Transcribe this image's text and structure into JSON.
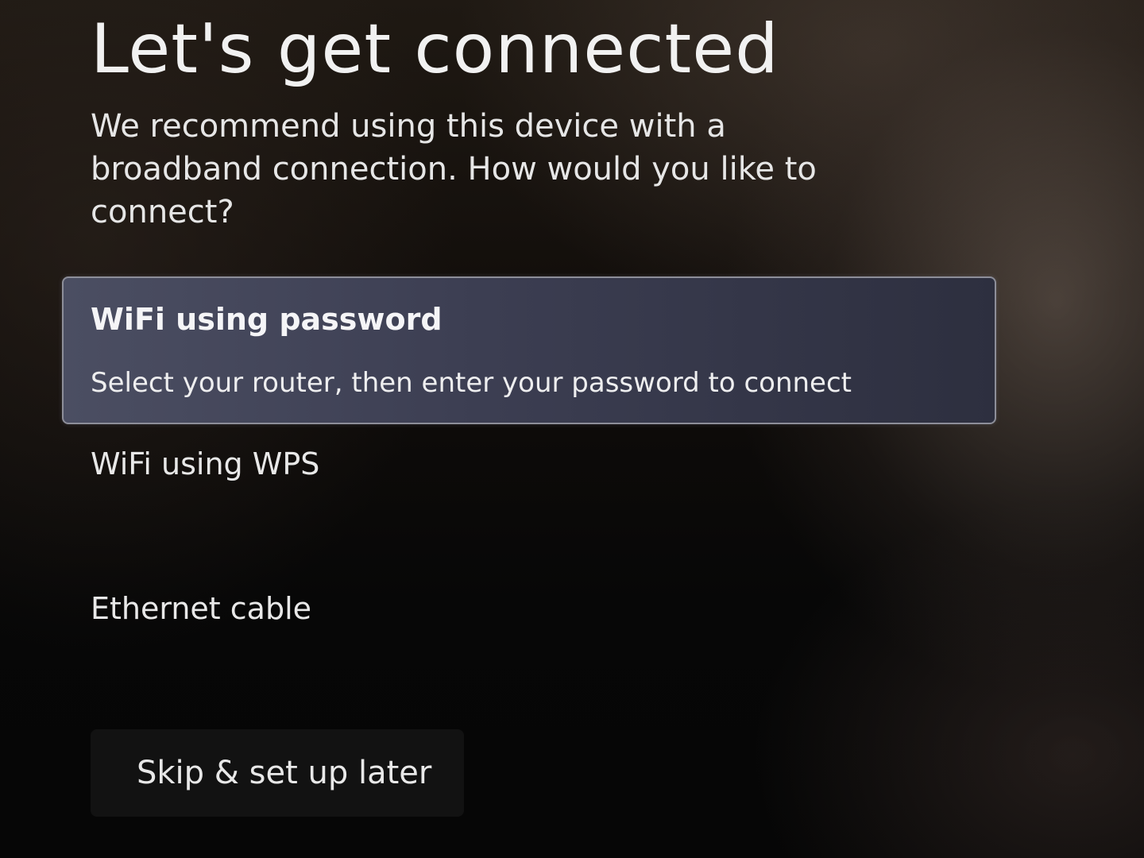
{
  "header": {
    "title": "Let's get connected",
    "subtitle": "We recommend using this device with a broadband connection. How would you like to connect?"
  },
  "options": [
    {
      "label": "WiFi using password",
      "description": "Select your router, then enter your password to connect",
      "selected": true
    },
    {
      "label": "WiFi using WPS",
      "selected": false
    },
    {
      "label": "Ethernet cable",
      "selected": false
    }
  ],
  "skip": {
    "label": "Skip & set up later"
  },
  "colors": {
    "selected_highlight": "#3c3e52",
    "text": "#e9e9ea"
  }
}
